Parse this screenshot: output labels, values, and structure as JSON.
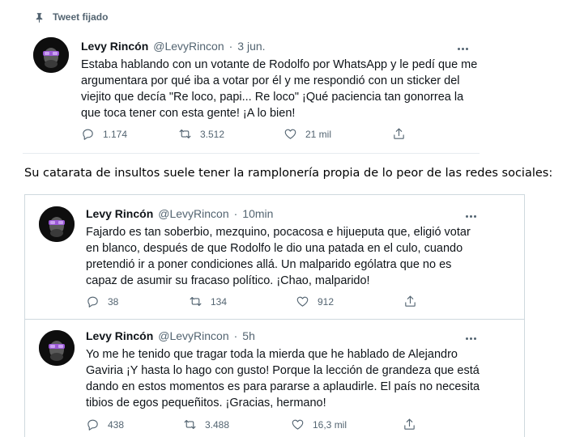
{
  "pinned_label": "Tweet fijado",
  "caption": "Su catarata de insultos suele tener la ramplonería propia de lo peor de las redes sociales:",
  "tweets": [
    {
      "name": "Levy Rincón",
      "handle": "@LevyRincon",
      "separator": "·",
      "time": "3 jun.",
      "lines": [
        "Estaba hablando con un votante de Rodolfo por WhatsApp y le pedí que me",
        "argumentara por qué iba a votar por él y me respondió con un sticker del",
        "viejito que decía \"Re loco, papi... Re loco\" ¡Qué paciencia tan gonorrea la",
        "que toca tener con esta gente! ¡A lo bien!"
      ],
      "replies": "1.174",
      "retweets": "3.512",
      "likes": "21 mil"
    },
    {
      "name": "Levy Rincón",
      "handle": "@LevyRincon",
      "separator": "·",
      "time": "10min",
      "lines": [
        "Fajardo es tan soberbio, mezquino, pocacosa e hijueputa que, eligió votar",
        "en blanco, después de que Rodolfo le dio una patada en el culo, cuando",
        "pretendió ir a poner condiciones allá. Un malparido ególatra que no es",
        "capaz de asumir su fracaso político. ¡Chao, malparido!"
      ],
      "replies": "38",
      "retweets": "134",
      "likes": "912"
    },
    {
      "name": "Levy Rincón",
      "handle": "@LevyRincon",
      "separator": "·",
      "time": "5h",
      "lines": [
        "Yo me he tenido que tragar toda la mierda que he hablado de Alejandro",
        "Gaviria ¡Y hasta lo hago con gusto! Porque la lección de grandeza que está",
        "dando en estos momentos es para pararse a aplaudirle. El país no necesita",
        "tibios de egos pequeñitos. ¡Gracias, hermano!"
      ],
      "replies": "438",
      "retweets": "3.488",
      "likes": "16,3 mil"
    }
  ]
}
